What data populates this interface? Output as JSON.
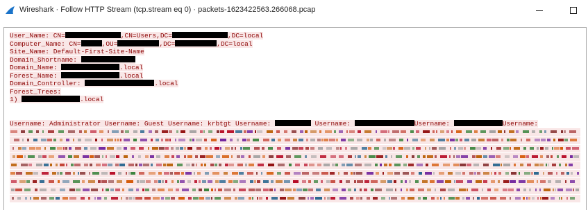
{
  "window": {
    "title": "Wireshark · Follow HTTP Stream (tcp.stream eq 0) · packets-1623422563.266068.pcap",
    "icon": "wireshark-fin-icon",
    "controls": [
      "minimize-icon",
      "maximize-icon"
    ]
  },
  "stream": {
    "text_color": "#8b0000",
    "highlight_color": "#f9e7e7",
    "user_name": {
      "label": "User_Name: CN=",
      "part2": ",CN=Users,DC=",
      "part3": ",DC=local"
    },
    "computer_name": {
      "label": "Computer_Name: CN=",
      "part2": ",OU=",
      "part3": ",DC=",
      "part4": ",DC=local"
    },
    "site_name": {
      "text": "Site_Name: Default-First-Site-Name"
    },
    "domain_shortname": {
      "label": "Domain_Shortname:"
    },
    "domain_name": {
      "label": "Domain_Name:",
      "suffix": ".local"
    },
    "forest_name": {
      "label": "Forest_Name:",
      "suffix": ".local"
    },
    "domain_controller": {
      "label": "Domain_Controller:",
      "suffix": ".local"
    },
    "forest_trees": {
      "label": "Forest_Trees:",
      "item_index": "1)",
      "item_suffix": ".local"
    },
    "usernames": {
      "text": "Username: Administrator Username: Guest Username: krbtgt Username:",
      "u5": "Username:",
      "u6": "Username:",
      "u7": "Username:"
    }
  }
}
